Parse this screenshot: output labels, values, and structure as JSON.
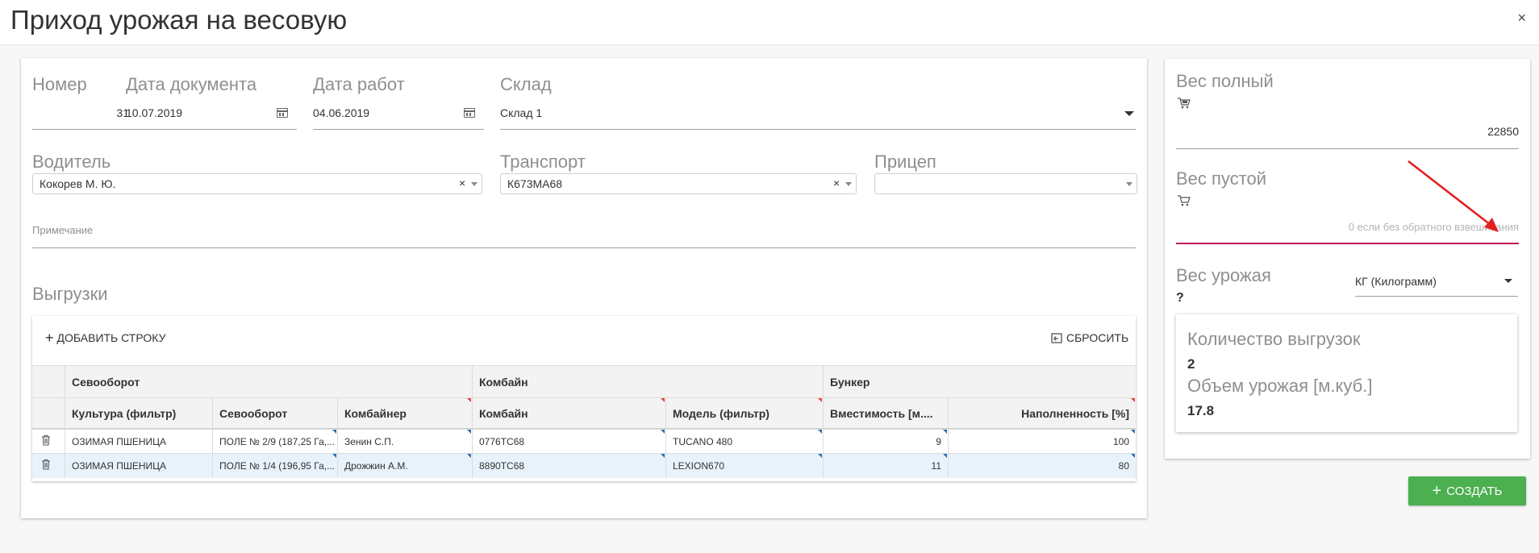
{
  "window": {
    "title": "Приход урожая на весовую",
    "close_label": "×"
  },
  "form": {
    "number": {
      "label": "Номер",
      "value": "31"
    },
    "doc_date": {
      "label": "Дата документа",
      "value": "10.07.2019"
    },
    "work_date": {
      "label": "Дата работ",
      "value": "04.06.2019"
    },
    "warehouse": {
      "label": "Склад",
      "value": "Склад 1"
    },
    "driver": {
      "label": "Водитель",
      "value": "Кокорев М. Ю.",
      "clear": "×"
    },
    "transport": {
      "label": "Транспорт",
      "value": "К673МА68",
      "clear": "×"
    },
    "trailer": {
      "label": "Прицеп",
      "value": ""
    },
    "note": {
      "placeholder": "Примечание"
    }
  },
  "unloads": {
    "title": "Выгрузки",
    "add_row_label": "ДОБАВИТЬ СТРОКУ",
    "reset_label": "СБРОСИТЬ",
    "group_headers": [
      "Севооборот",
      "Комбайн",
      "Бункер"
    ],
    "columns": [
      "Культура (фильтр)",
      "Севооборот",
      "Комбайнер",
      "Комбайн",
      "Модель (фильтр)",
      "Вместимость [м....",
      "Наполненность [%]"
    ],
    "rows": [
      [
        "ОЗИМАЯ ПШЕНИЦА",
        "ПОЛЕ № 2/9 (187,25 Га,...",
        "Зенин С.П.",
        "0776ТС68",
        "TUCANO 480",
        "9",
        "100"
      ],
      [
        "ОЗИМАЯ ПШЕНИЦА",
        "ПОЛЕ № 1/4 (196,95 Га,...",
        "Дрожжин А.М.",
        "8890ТС68",
        "LEXION670",
        "11",
        "80"
      ]
    ]
  },
  "weights": {
    "full": {
      "label": "Вес полный",
      "value": "22850"
    },
    "empty": {
      "label": "Вес пустой",
      "placeholder": "0 если без обратного взвешивания"
    },
    "crop": {
      "label": "Вес урожая",
      "value": "?",
      "unit": "КГ (Килограмм)"
    }
  },
  "summary": {
    "count_label": "Количество выгрузок",
    "count_value": "2",
    "volume_label": "Объем урожая [м.куб.]",
    "volume_value": "17.8"
  },
  "actions": {
    "create_label": "СОЗДАТЬ"
  },
  "colors": {
    "accent_red": "#e0463c",
    "create_green": "#4caf50",
    "focus_line": "#c2185b"
  }
}
